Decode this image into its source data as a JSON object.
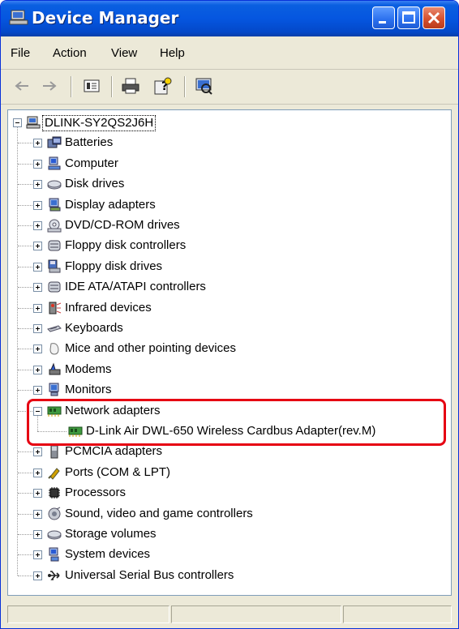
{
  "window": {
    "title": "Device Manager"
  },
  "menu": [
    "File",
    "Action",
    "View",
    "Help"
  ],
  "toolbar": {
    "buttons": [
      {
        "name": "back-arrow-icon"
      },
      {
        "name": "forward-arrow-icon"
      },
      {
        "name": "properties-icon"
      },
      {
        "name": "print-icon"
      },
      {
        "name": "help-icon"
      },
      {
        "name": "scan-hardware-icon"
      }
    ]
  },
  "tree": {
    "root": "DLINK-SY2QS2J6H",
    "categories": [
      {
        "label": "Batteries",
        "icon": "battery-icon",
        "expanded": false
      },
      {
        "label": "Computer",
        "icon": "computer-icon",
        "expanded": false
      },
      {
        "label": "Disk drives",
        "icon": "disk-drive-icon",
        "expanded": false
      },
      {
        "label": "Display adapters",
        "icon": "display-adapter-icon",
        "expanded": false
      },
      {
        "label": "DVD/CD-ROM drives",
        "icon": "dvd-drive-icon",
        "expanded": false
      },
      {
        "label": "Floppy disk controllers",
        "icon": "floppy-controller-icon",
        "expanded": false
      },
      {
        "label": "Floppy disk drives",
        "icon": "floppy-drive-icon",
        "expanded": false
      },
      {
        "label": "IDE ATA/ATAPI controllers",
        "icon": "ide-controller-icon",
        "expanded": false
      },
      {
        "label": "Infrared devices",
        "icon": "infrared-icon",
        "expanded": false
      },
      {
        "label": "Keyboards",
        "icon": "keyboard-icon",
        "expanded": false
      },
      {
        "label": "Mice and other pointing devices",
        "icon": "mouse-icon",
        "expanded": false
      },
      {
        "label": "Modems",
        "icon": "modem-icon",
        "expanded": false
      },
      {
        "label": "Monitors",
        "icon": "monitor-icon",
        "expanded": false
      },
      {
        "label": "Network adapters",
        "icon": "network-adapter-icon",
        "expanded": true,
        "children": [
          "D-Link Air DWL-650 Wireless Cardbus Adapter(rev.M)"
        ]
      },
      {
        "label": "PCMCIA adapters",
        "icon": "pcmcia-icon",
        "expanded": false
      },
      {
        "label": "Ports (COM & LPT)",
        "icon": "port-icon",
        "expanded": false
      },
      {
        "label": "Processors",
        "icon": "processor-icon",
        "expanded": false
      },
      {
        "label": "Sound, video and game controllers",
        "icon": "sound-icon",
        "expanded": false
      },
      {
        "label": "Storage volumes",
        "icon": "storage-volume-icon",
        "expanded": false
      },
      {
        "label": "System devices",
        "icon": "system-device-icon",
        "expanded": false
      },
      {
        "label": "Universal Serial Bus controllers",
        "icon": "usb-icon",
        "expanded": false
      }
    ]
  },
  "colors": {
    "highlight": "#e60012",
    "titlebar": "#0556e0"
  }
}
